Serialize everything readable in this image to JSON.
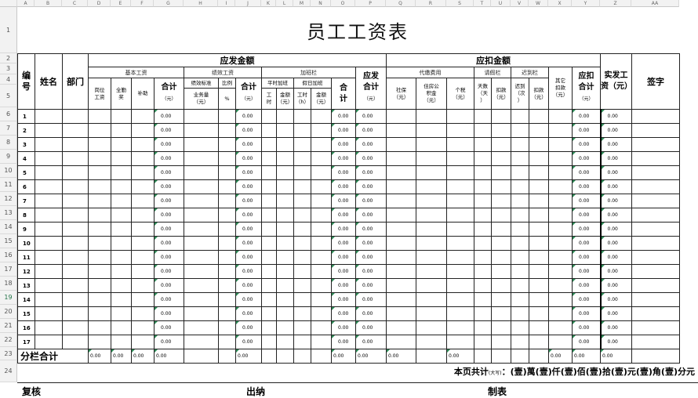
{
  "col_headers": [
    "A",
    "B",
    "C",
    "D",
    "E",
    "F",
    "G",
    "H",
    "I",
    "J",
    "K",
    "L",
    "M",
    "N",
    "O",
    "P",
    "Q",
    "R",
    "S",
    "T",
    "U",
    "V",
    "W",
    "X",
    "Y",
    "Z",
    "AA"
  ],
  "row_headers": [
    "1",
    "2",
    "3",
    "4",
    "5",
    "6",
    "7",
    "8",
    "9",
    "10",
    "11",
    "12",
    "13",
    "14",
    "15",
    "16",
    "17",
    "18",
    "19",
    "20",
    "21",
    "22",
    "23",
    "24"
  ],
  "sheet": {
    "title": "员工工资表",
    "headers": {
      "no": "编号",
      "name": "姓名",
      "dept": "部门",
      "payable": "应发金额",
      "deduct": "应扣金额",
      "basic": "基本工资",
      "perf": "绩效工资",
      "overtime": "加班栏",
      "pos_wage": "岗位工资",
      "full_att": "全勤奖",
      "subsidy": "补助",
      "subtotal": "合计",
      "unit_yuan": "（元）",
      "perf_std": "绩效标准",
      "ratio": "比例",
      "biz_amount": "业务量（元）",
      "pct": "%",
      "ot_normal": "平时加班",
      "ot_holiday": "假日加班",
      "hours": "工时",
      "amount": "金额（元）",
      "hours_h": "工时（h）",
      "ot_total": "合计",
      "gross": "应发合计（元）",
      "withheld": "代缴费用",
      "social": "社保（元）",
      "housing": "住房公积金（元）",
      "tax": "个税（元）",
      "leave": "请假栏",
      "late": "迟到栏",
      "days": "天数（天）",
      "deduct_amt": "扣款（元）",
      "late_times": "迟到（次）",
      "other_deduct": "其它扣款（元）",
      "deduct_total": "应扣合计（元）",
      "net_pay": "实发工资（元）",
      "sign": "签字"
    },
    "rows": [
      {
        "no": "1",
        "g": "0.00",
        "j": "0.00",
        "o": "0.00",
        "p": "0.00",
        "y": "0.00",
        "z": "0.00"
      },
      {
        "no": "2",
        "g": "0.00",
        "j": "0.00",
        "o": "0.00",
        "p": "0.00",
        "y": "0.00",
        "z": "0.00"
      },
      {
        "no": "3",
        "g": "0.00",
        "j": "0.00",
        "o": "0.00",
        "p": "0.00",
        "y": "0.00",
        "z": "0.00"
      },
      {
        "no": "4",
        "g": "0.00",
        "j": "0.00",
        "o": "0.00",
        "p": "0.00",
        "y": "0.00",
        "z": "0.00"
      },
      {
        "no": "5",
        "g": "0.00",
        "j": "0.00",
        "o": "0.00",
        "p": "0.00",
        "y": "0.00",
        "z": "0.00"
      },
      {
        "no": "6",
        "g": "0.00",
        "j": "0.00",
        "o": "0.00",
        "p": "0.00",
        "y": "0.00",
        "z": "0.00"
      },
      {
        "no": "7",
        "g": "0.00",
        "j": "0.00",
        "o": "0.00",
        "p": "0.00",
        "y": "0.00",
        "z": "0.00"
      },
      {
        "no": "8",
        "g": "0.00",
        "j": "0.00",
        "o": "0.00",
        "p": "0.00",
        "y": "0.00",
        "z": "0.00"
      },
      {
        "no": "9",
        "g": "0.00",
        "j": "0.00",
        "o": "0.00",
        "p": "0.00",
        "y": "0.00",
        "z": "0.00"
      },
      {
        "no": "10",
        "g": "0.00",
        "j": "0.00",
        "o": "0.00",
        "p": "0.00",
        "y": "0.00",
        "z": "0.00"
      },
      {
        "no": "11",
        "g": "0.00",
        "j": "0.00",
        "o": "0.00",
        "p": "0.00",
        "y": "0.00",
        "z": "0.00"
      },
      {
        "no": "12",
        "g": "0.00",
        "j": "0.00",
        "o": "0.00",
        "p": "0.00",
        "y": "0.00",
        "z": "0.00"
      },
      {
        "no": "13",
        "g": "0.00",
        "j": "0.00",
        "o": "0.00",
        "p": "0.00",
        "y": "0.00",
        "z": "0.00"
      },
      {
        "no": "14",
        "g": "0.00",
        "j": "0.00",
        "o": "0.00",
        "p": "0.00",
        "y": "0.00",
        "z": "0.00"
      },
      {
        "no": "15",
        "g": "0.00",
        "j": "0.00",
        "o": "0.00",
        "p": "0.00",
        "y": "0.00",
        "z": "0.00"
      },
      {
        "no": "16",
        "g": "0.00",
        "j": "0.00",
        "o": "0.00",
        "p": "0.00",
        "y": "0.00",
        "z": "0.00"
      },
      {
        "no": "17",
        "g": "0.00",
        "j": "0.00",
        "o": "0.00",
        "p": "0.00",
        "y": "0.00",
        "z": "0.00"
      }
    ],
    "total": {
      "label": "分栏合计",
      "d": "0.00",
      "e": "0.00",
      "f": "0.00",
      "g": "0.00",
      "j": "0.00",
      "o": "0.00",
      "p": "0.00",
      "q": "0.00",
      "s": "0.00",
      "x": "0.00",
      "y": "0.00",
      "z": "0.00"
    },
    "page_total": {
      "label": "本页共计",
      "note": "(大写)",
      "text": "：(壹)萬(壹)仟(壹)佰(壹)拾(壹)元(壹)角(壹)分元"
    },
    "footer_cut": [
      "复核",
      "出纳",
      "制表"
    ]
  },
  "accent": "#217346"
}
